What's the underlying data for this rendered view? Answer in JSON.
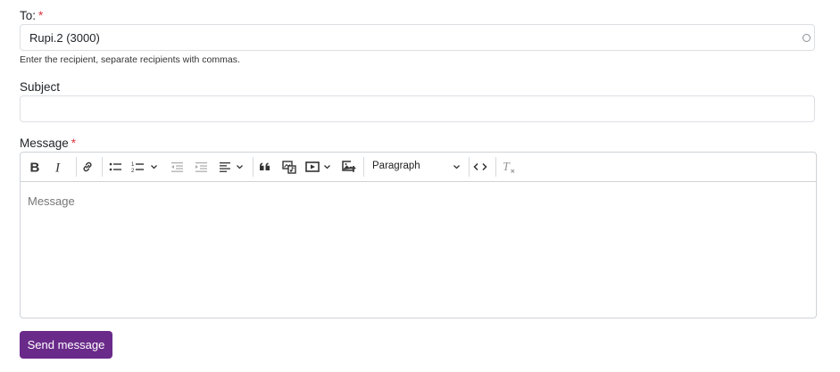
{
  "to": {
    "label": "To:",
    "required_mark": "*",
    "value": "Rupi.2 (3000)",
    "help": "Enter the recipient, separate recipients with commas."
  },
  "subject": {
    "label": "Subject",
    "value": ""
  },
  "message": {
    "label": "Message",
    "required_mark": "*",
    "placeholder": "Message",
    "toolbar": {
      "block_format": "Paragraph",
      "icons": [
        "bold-icon",
        "italic-icon",
        "link-icon",
        "bulleted-list-icon",
        "numbered-list-icon",
        "outdent-icon",
        "indent-icon",
        "align-icon",
        "blockquote-icon",
        "media-icon",
        "video-icon",
        "image-upload-icon",
        "source-code-icon",
        "clear-formatting-icon"
      ]
    }
  },
  "send_button": {
    "label": "Send message",
    "color": "#6a2a8a"
  },
  "colors": {
    "required": "#dc3545",
    "text": "#212529",
    "border": "#dcdfe3"
  }
}
